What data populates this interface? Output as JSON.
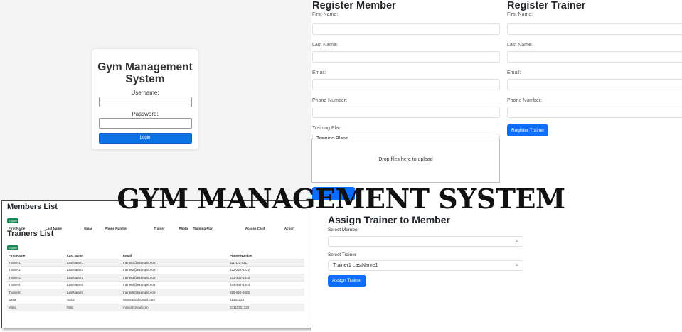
{
  "login": {
    "title_line1": "Gym Management",
    "title_line2": "System",
    "username_label": "Username:",
    "password_label": "Password:",
    "login_button": "Login"
  },
  "register_member": {
    "heading": "Register Member",
    "first_name_label": "First Name:",
    "last_name_label": "Last Name:",
    "email_label": "Email:",
    "phone_label": "Phone Number:",
    "training_plan_label": "Training Plan:",
    "training_plan_value": "Training Plans",
    "dropzone_text": "Drop files here to upload"
  },
  "register_trainer": {
    "heading": "Register Trainer",
    "first_name_label": "First Name:",
    "last_name_label": "Last Name:",
    "email_label": "Email:",
    "phone_label": "Phone Number:",
    "register_button": "Register Trainer"
  },
  "banner": {
    "text": "GYM MANAGEMENT SYSTEM"
  },
  "members_list": {
    "heading": "Members List",
    "export_label": "Export",
    "columns": [
      "First Name",
      "Last Name",
      "Email",
      "Phone Number",
      "Trainer",
      "Photo",
      "Training Plan",
      "Access Card",
      "Action"
    ]
  },
  "trainers_list": {
    "heading": "Trainers List",
    "export_label": "Export",
    "columns": [
      "First Name",
      "Last Name",
      "Email",
      "Phone Number"
    ],
    "rows": [
      [
        "Trainer1",
        "LastName1",
        "trainer1@example.com",
        "111-111-1111"
      ],
      [
        "Trainer2",
        "LastName2",
        "trainer2@example.com",
        "222-222-2222"
      ],
      [
        "Trainer3",
        "LastName3",
        "trainer3@example.com",
        "333-333-3333"
      ],
      [
        "Trainer4",
        "LastName4",
        "trainer4@example.com",
        "444-444-4444"
      ],
      [
        "Trainer5",
        "LastName5",
        "trainer5@example.com",
        "555-555-5555"
      ],
      [
        "Sasa",
        "Sasic",
        "sasasasic@gmail.com",
        "21343223"
      ],
      [
        "Milos",
        "Milic",
        "milos@gmail.com",
        "23112321322"
      ]
    ]
  },
  "assign": {
    "heading": "Assign Trainer to Member",
    "select_member_label": "Select Member",
    "select_member_value": "",
    "select_trainer_label": "Select Trainer",
    "select_trainer_value": "Trainer1 LastName1",
    "assign_button": "Assign Trainer"
  },
  "colors": {
    "primary": "#0d6efd",
    "success": "#198754",
    "login_bg": "#f4f4f4"
  }
}
